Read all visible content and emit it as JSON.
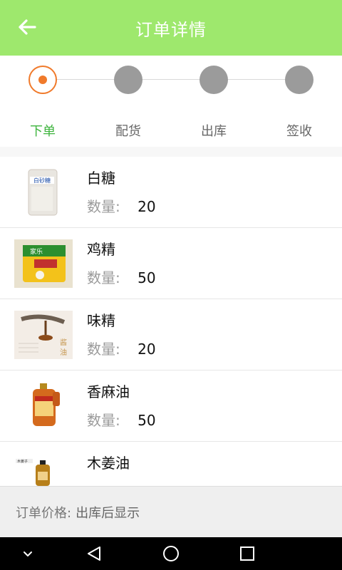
{
  "header": {
    "title": "订单详情",
    "back_icon": "arrow-left-icon",
    "bg": "#9ee86d"
  },
  "steps": [
    {
      "label": "下单",
      "state": "active"
    },
    {
      "label": "配货",
      "state": "pending"
    },
    {
      "label": "出库",
      "state": "pending"
    },
    {
      "label": "签收",
      "state": "pending"
    }
  ],
  "items": [
    {
      "name": "白糖",
      "qty_label": "数量:",
      "qty": "20",
      "thumb": "sugar-bag-image"
    },
    {
      "name": "鸡精",
      "qty_label": "数量:",
      "qty": "50",
      "thumb": "chicken-essence-bag-image"
    },
    {
      "name": "味精",
      "qty_label": "数量:",
      "qty": "20",
      "thumb": "soy-sauce-image"
    },
    {
      "name": "香麻油",
      "qty_label": "数量:",
      "qty": "50",
      "thumb": "sesame-oil-jug-image"
    },
    {
      "name": "木姜油",
      "qty_label": "",
      "qty": "",
      "thumb": "litsea-oil-bottle-image"
    }
  ],
  "footer": {
    "label": "订单价格:",
    "value": "出库后显示"
  },
  "nav": {
    "buttons": [
      "chevron-down-icon",
      "back-triangle-icon",
      "home-circle-icon",
      "recents-square-icon"
    ]
  }
}
